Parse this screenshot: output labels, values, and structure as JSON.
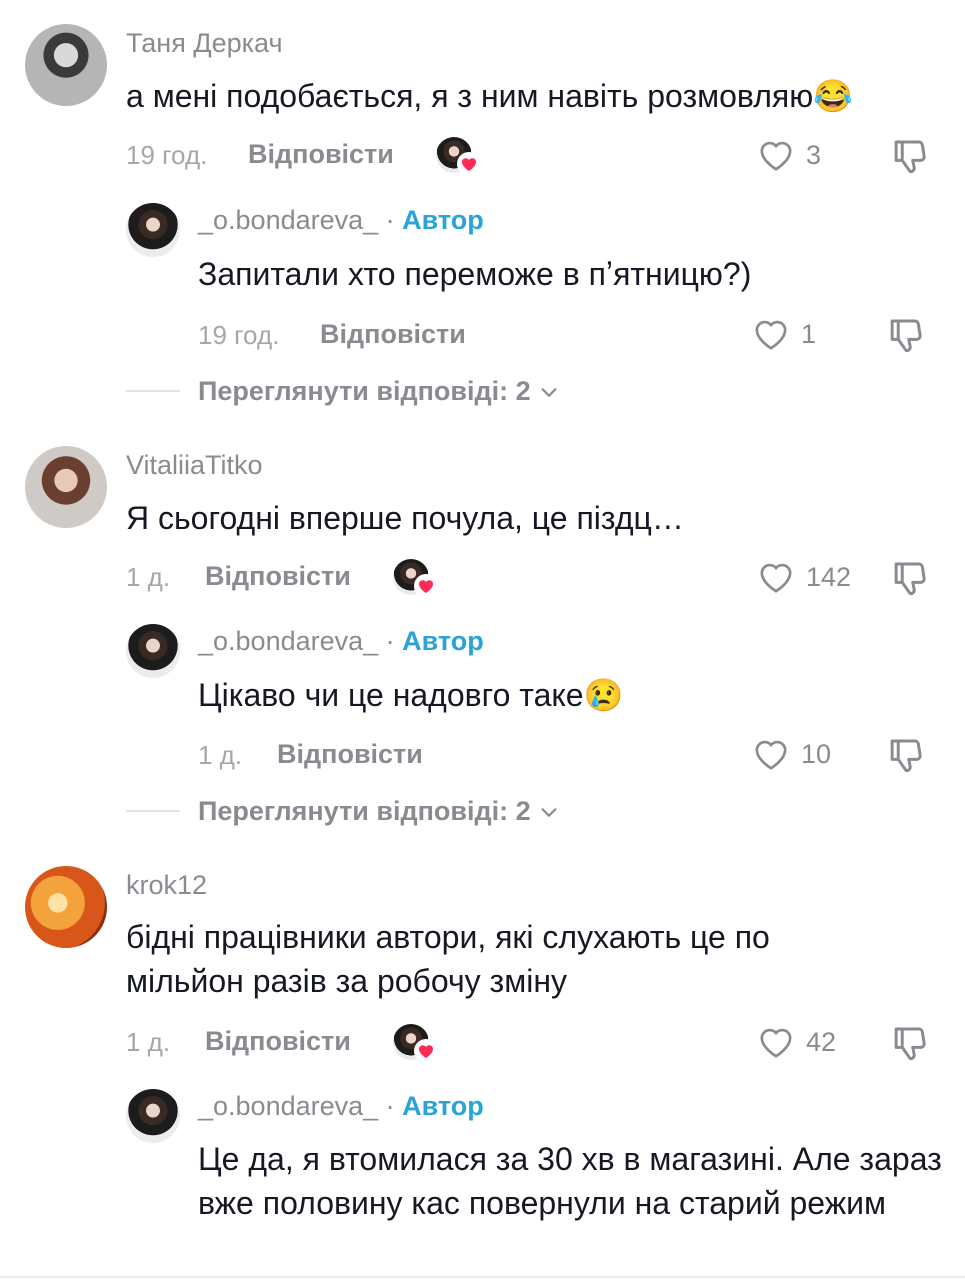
{
  "comments": [
    {
      "username": "Таня Деркач",
      "text": "а мені подобається, я з ним навіть розмовляю",
      "emoji": "😂",
      "time": "19 год.",
      "reply_label": "Відповісти",
      "likes": "3",
      "reply": {
        "username": "_o.bondareva_",
        "author_label": "Автор",
        "text": "Запитали хто переможе в пʼятницю?)",
        "time": "19 год.",
        "reply_label": "Відповісти",
        "likes": "1"
      },
      "view_replies": "Переглянути відповіді: 2"
    },
    {
      "username": "VitaliiaTitko",
      "text": "Я сьогодні вперше почула, це піздц…",
      "time": "1 д.",
      "reply_label": "Відповісти",
      "likes": "142",
      "reply": {
        "username": "_o.bondareva_",
        "author_label": "Автор",
        "text": "Цікаво чи це надовго таке",
        "emoji": "😢",
        "time": "1 д.",
        "reply_label": "Відповісти",
        "likes": "10"
      },
      "view_replies": "Переглянути відповіді: 2"
    },
    {
      "username": "krok12",
      "text": "бідні працівники автори, які слухають це по мільйон разів за робочу зміну",
      "time": "1 д.",
      "reply_label": "Відповісти",
      "likes": "42",
      "reply": {
        "username": "_o.bondareva_",
        "author_label": "Автор",
        "text": "Це да, я втомилася за 30 хв в магазині. Але зараз вже половину кас повернули на старий режим"
      }
    }
  ],
  "colors": {
    "author_accent": "#2aa3d6",
    "heart": "#fe2c55"
  },
  "icons": {
    "like": "heart-outline-icon",
    "dislike": "thumbs-down-icon",
    "creator_liked": "creator-liked-heart-icon"
  }
}
